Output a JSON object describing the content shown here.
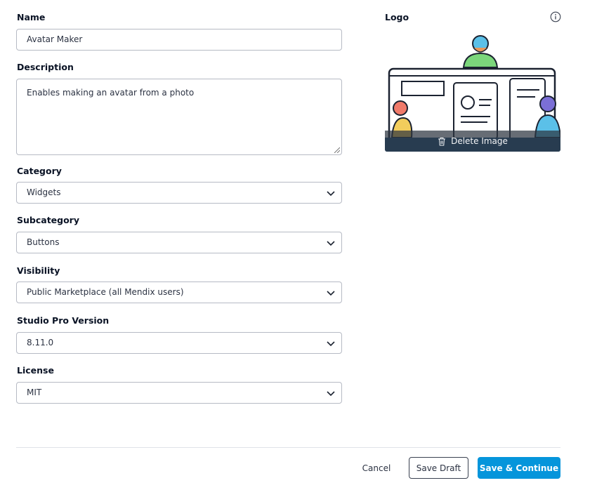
{
  "form": {
    "name": {
      "label": "Name",
      "value": "Avatar Maker"
    },
    "description": {
      "label": "Description",
      "value": "Enables making an avatar from a photo"
    },
    "category": {
      "label": "Category",
      "value": "Widgets"
    },
    "subcategory": {
      "label": "Subcategory",
      "value": "Buttons"
    },
    "visibility": {
      "label": "Visibility",
      "value": "Public Marketplace (all Mendix users)"
    },
    "studio_pro_version": {
      "label": "Studio Pro Version",
      "value": "8.11.0"
    },
    "license": {
      "label": "License",
      "value": "MIT"
    }
  },
  "logo": {
    "label": "Logo",
    "delete_label": "Delete Image",
    "info_icon": "info-icon",
    "delete_icon": "trash-icon"
  },
  "footer": {
    "cancel_label": "Cancel",
    "save_draft_label": "Save Draft",
    "save_continue_label": "Save & Continue"
  },
  "colors": {
    "primary": "#0595db",
    "border": "#b6bac4",
    "text": "#0a1325"
  }
}
